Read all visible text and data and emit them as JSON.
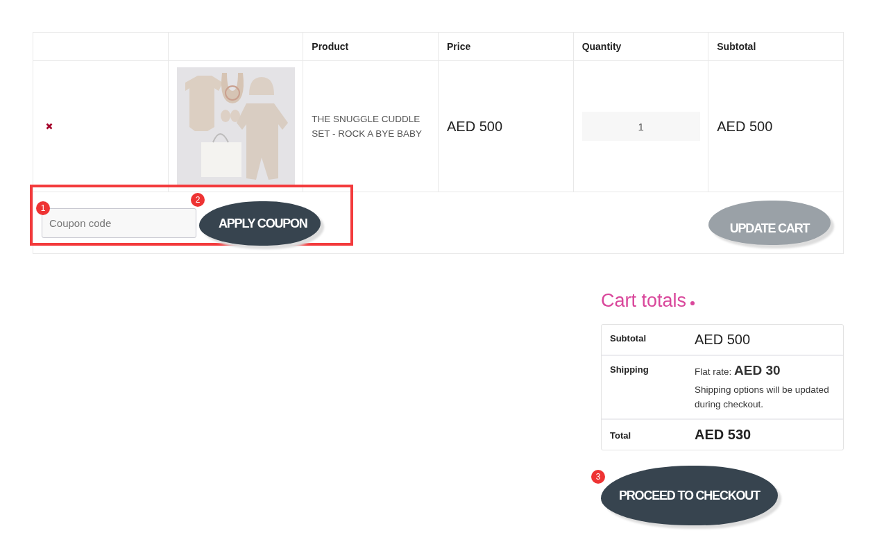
{
  "table": {
    "columns": [
      "Product",
      "Price",
      "Quantity",
      "Subtotal"
    ],
    "rows": [
      {
        "product": "THE SNUGGLE CUDDLE SET - ROCK A BYE BABY",
        "price": "AED 500",
        "quantity": "1",
        "subtotal": "AED 500"
      }
    ]
  },
  "coupon": {
    "placeholder": "Coupon code",
    "marker": "1",
    "highlighted": true
  },
  "apply_button": {
    "label": "APPLY COUPON",
    "marker": "2"
  },
  "update_button": {
    "label": "UPDATE CART",
    "disabled": true
  },
  "cart_totals": {
    "title": "Cart totals",
    "subtotal_label": "Subtotal",
    "subtotal": "AED 500",
    "shipping_label": "Shipping",
    "shipping_rate": "Flat rate: **AED 30**",
    "shipping_note": "Shipping options will be updated during checkout.",
    "total_label": "Total",
    "total": "AED 530"
  },
  "checkout_button": {
    "label": "PROCEED TO CHECKOUT",
    "marker": "3"
  }
}
